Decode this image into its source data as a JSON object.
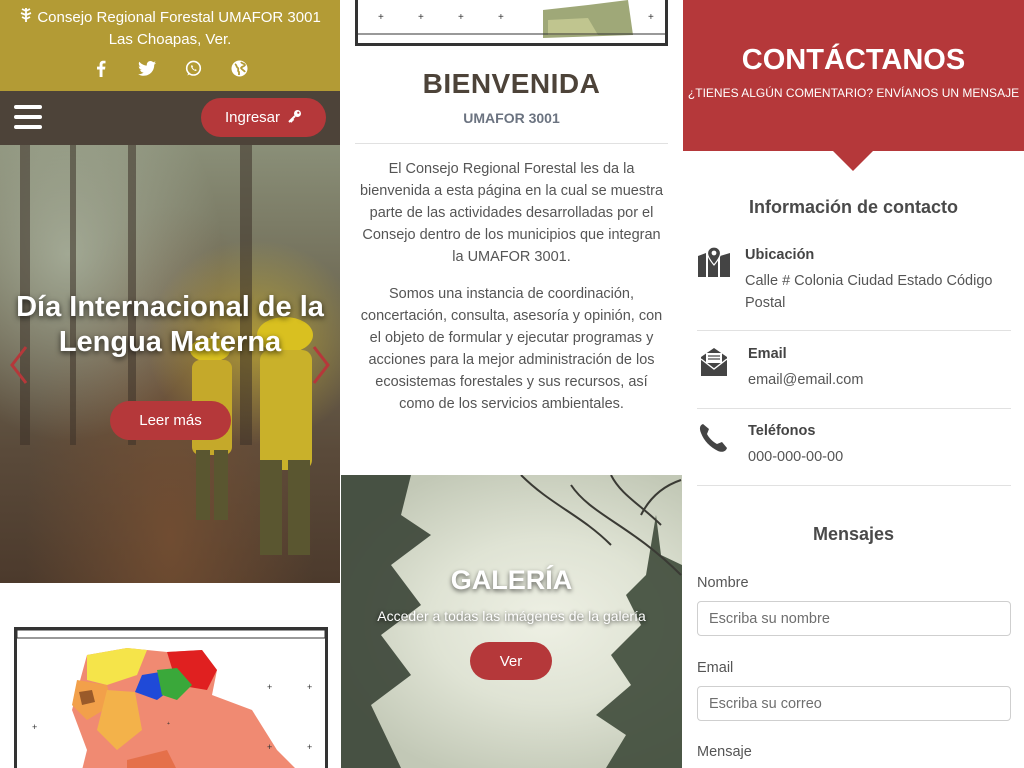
{
  "header": {
    "line1": "Consejo Regional Forestal UMAFOR 3001",
    "line2": "Las Choapas, Ver.",
    "social_icons": [
      "facebook-icon",
      "twitter-icon",
      "whatsapp-icon",
      "globe-icon"
    ]
  },
  "navbar": {
    "login_label": "Ingresar"
  },
  "hero": {
    "title": "Día Internacional de la Lengua Materna",
    "button_label": "Leer más"
  },
  "welcome": {
    "title": "BIENVENIDA",
    "subtitle": "UMAFOR 3001",
    "paragraph1": "El Consejo Regional Forestal les da la bienvenida a esta página en la cual se muestra parte de las actividades desarrolladas por el Consejo dentro de los municipios que integran la UMAFOR 3001.",
    "paragraph2": "Somos una instancia de coordinación, concertación, consulta, asesoría y opinión, con el objeto de formular y ejecutar programas y acciones para la mejor administración de los ecosistemas forestales y sus recursos, así como de los servicios ambientales."
  },
  "gallery": {
    "title": "GALERÍA",
    "subtitle": "Acceder a todas las imágenes de la galería",
    "button_label": "Ver"
  },
  "contact": {
    "title": "CONTÁCTANOS",
    "subtitle": "¿TIENES ALGÚN COMENTARIO? ENVÍANOS UN MENSAJE",
    "info_title": "Información de contacto",
    "location_label": "Ubicación",
    "location_value": "Calle # Colonia Ciudad Estado Código Postal",
    "email_label": "Email",
    "email_value": "email@email.com",
    "phone_label": "Teléfonos",
    "phone_value": "000-000-00-00"
  },
  "messages": {
    "title": "Mensajes",
    "name_label": "Nombre",
    "name_placeholder": "Escriba su nombre",
    "email_label": "Email",
    "email_placeholder": "Escriba su correo",
    "message_label": "Mensaje"
  },
  "colors": {
    "gold": "#b39b35",
    "dark_brown": "#4d4339",
    "accent_red": "#b5383a"
  }
}
